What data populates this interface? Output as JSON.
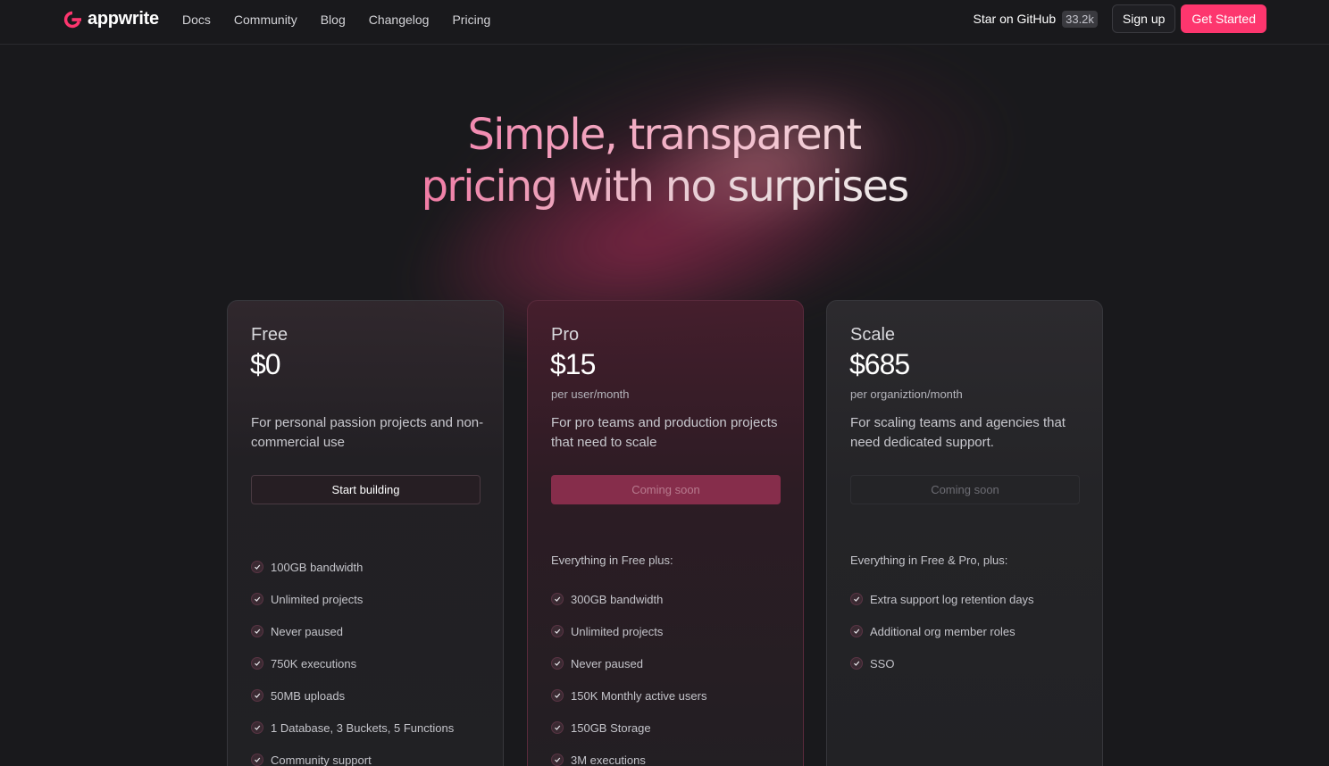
{
  "nav": {
    "logo_text": "appwrite",
    "links": [
      "Docs",
      "Community",
      "Blog",
      "Changelog",
      "Pricing"
    ],
    "github_label": "Star on GitHub",
    "github_count": "33.2k",
    "signup_label": "Sign up",
    "cta_label": "Get Started"
  },
  "hero": {
    "line1": "Simple, transparent",
    "line2": "pricing with no surprises"
  },
  "plans": [
    {
      "name": "Free",
      "price": "$0",
      "unit": "",
      "description": "For personal passion projects and non-commercial use",
      "button": "Start building",
      "features_heading": "",
      "features": [
        "100GB bandwidth",
        "Unlimited projects",
        "Never paused",
        "750K executions",
        "50MB uploads",
        "1 Database, 3 Buckets, 5 Functions",
        "Community support"
      ]
    },
    {
      "name": "Pro",
      "price": "$15",
      "unit": "per user/month",
      "description": "For pro teams and production projects that need to scale",
      "button": "Coming soon",
      "features_heading": "Everything in Free plus:",
      "features": [
        "300GB bandwidth",
        "Unlimited projects",
        "Never paused",
        "150K Monthly active users",
        "150GB Storage",
        "3M executions"
      ]
    },
    {
      "name": "Scale",
      "price": "$685",
      "unit": "per organiztion/month",
      "description": "For scaling teams and agencies that need dedicated support.",
      "button": "Coming soon",
      "features_heading": "Everything in Free & Pro, plus:",
      "features": [
        "Extra support log retention days",
        "Additional org member roles",
        "SSO"
      ]
    }
  ],
  "colors": {
    "accent": "#fd366e",
    "background": "#19191c"
  }
}
